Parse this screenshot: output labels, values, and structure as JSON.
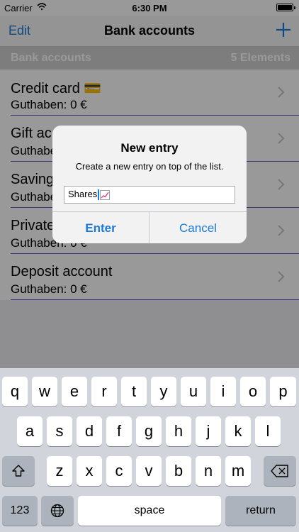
{
  "status": {
    "carrier": "Carrier",
    "time": "6:30 PM"
  },
  "navbar": {
    "edit_label": "Edit",
    "title": "Bank accounts"
  },
  "section": {
    "title": "Bank accounts",
    "count": "5 Elements"
  },
  "accounts": [
    {
      "name": "Credit card 💳",
      "balance": "Guthaben: 0 €"
    },
    {
      "name": "Gift ac",
      "balance": "Guthabe"
    },
    {
      "name": "Saving",
      "balance": "Guthabe"
    },
    {
      "name": "Private",
      "balance": "Guthaben: 0 €"
    },
    {
      "name": "Deposit account",
      "balance": "Guthaben: 0 €"
    }
  ],
  "alert": {
    "title": "New entry",
    "message": "Create a new entry on top of the list.",
    "input_value": "Shares",
    "enter_label": "Enter",
    "cancel_label": "Cancel"
  },
  "keyboard": {
    "row1": [
      "q",
      "w",
      "e",
      "r",
      "t",
      "y",
      "u",
      "i",
      "o",
      "p"
    ],
    "row2": [
      "a",
      "s",
      "d",
      "f",
      "g",
      "h",
      "j",
      "k",
      "l"
    ],
    "row3": [
      "z",
      "x",
      "c",
      "v",
      "b",
      "n",
      "m"
    ],
    "numbers_label": "123",
    "space_label": "space",
    "return_label": "return"
  },
  "colors": {
    "accent": "#1a7ad9",
    "separator": "#5a5ad6"
  }
}
